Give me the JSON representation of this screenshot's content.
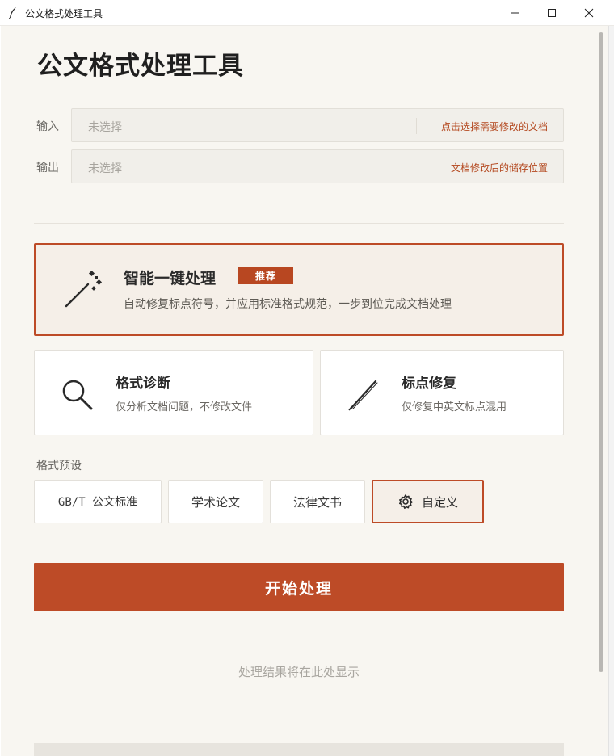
{
  "window": {
    "title": "公文格式处理工具",
    "icon": "feather-icon"
  },
  "page": {
    "title": "公文格式处理工具"
  },
  "io": {
    "input": {
      "label": "输入",
      "placeholder": "未选择",
      "action": "点击选择需要修改的文档"
    },
    "output": {
      "label": "输出",
      "placeholder": "未选择",
      "action": "文档修改后的储存位置"
    }
  },
  "smart": {
    "title": "智能一键处理",
    "badge": "推荐",
    "desc": "自动修复标点符号，并应用标准格式规范，一步到位完成文档处理",
    "icon": "magic-wand-icon"
  },
  "modes": {
    "diagnose": {
      "title": "格式诊断",
      "desc": "仅分析文档问题，不修改文件",
      "icon": "search-icon"
    },
    "punct": {
      "title": "标点修复",
      "desc": "仅修复中英文标点混用",
      "icon": "pen-icon"
    }
  },
  "presets": {
    "label": "格式预设",
    "items": [
      "GB/T 公文标准",
      "学术论文",
      "法律文书",
      "自定义"
    ],
    "selected": "自定义"
  },
  "start": {
    "label": "开始处理"
  },
  "result": {
    "placeholder": "处理结果将在此处显示"
  },
  "colors": {
    "accent": "#bd4b27",
    "background": "#f8f6f1",
    "selected_bg": "#f5efe8"
  }
}
